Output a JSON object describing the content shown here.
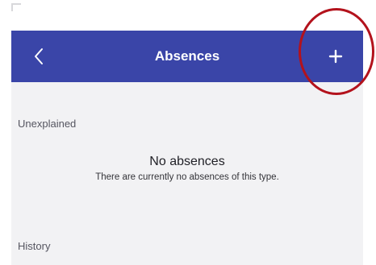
{
  "app_bar": {
    "title": "Absences",
    "back_icon": "chevron-left-icon",
    "add_icon": "plus-icon",
    "color": "#3a45a8"
  },
  "sections": {
    "unexplained_label": "Unexplained",
    "history_label": "History"
  },
  "empty_state": {
    "title": "No absences",
    "message": "There are currently no absences of this type."
  },
  "annotation": {
    "highlight_color": "#b3121c"
  }
}
